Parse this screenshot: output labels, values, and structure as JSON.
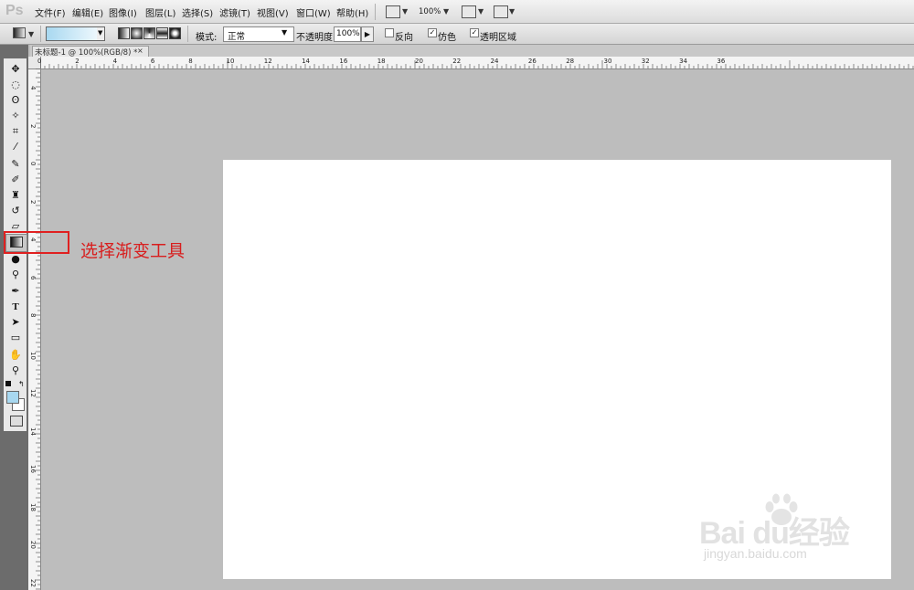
{
  "app": {
    "logo": "Ps"
  },
  "menu": {
    "items": [
      "文件(F)",
      "编辑(E)",
      "图像(I)",
      "图层(L)",
      "选择(S)",
      "滤镜(T)",
      "视图(V)",
      "窗口(W)",
      "帮助(H)"
    ],
    "zoom": "100%"
  },
  "options": {
    "mode_label": "模式:",
    "mode_value": "正常",
    "opacity_label": "不透明度:",
    "opacity_value": "100%",
    "reverse_label": "反向",
    "reverse_checked": false,
    "dither_label": "仿色",
    "dither_checked": true,
    "transparency_label": "透明区域",
    "transparency_checked": true,
    "gradient_start_color": "#a8d8f0",
    "gradient_end_color": "#eef8fd"
  },
  "document": {
    "tab_title": "未标题-1 @ 100%(RGB/8) *",
    "close_glyph": "×"
  },
  "rulers": {
    "top": [
      "0",
      "2",
      "4",
      "6",
      "8",
      "10",
      "12",
      "14",
      "16",
      "18",
      "20",
      "22",
      "24",
      "26",
      "28",
      "30",
      "32",
      "34",
      "36"
    ],
    "left": [
      "4",
      "2",
      "0",
      "2",
      "4",
      "6",
      "8",
      "10",
      "12",
      "14",
      "16",
      "18",
      "20",
      "22"
    ]
  },
  "toolbox": {
    "foreground_color": "#a8d8f0",
    "background_color": "#ffffff"
  },
  "annotation": {
    "text": "选择渐变工具",
    "color": "#e02020"
  },
  "watermark": {
    "logo_text": "Bai  du经验",
    "url": "jingyan.baidu.com"
  }
}
